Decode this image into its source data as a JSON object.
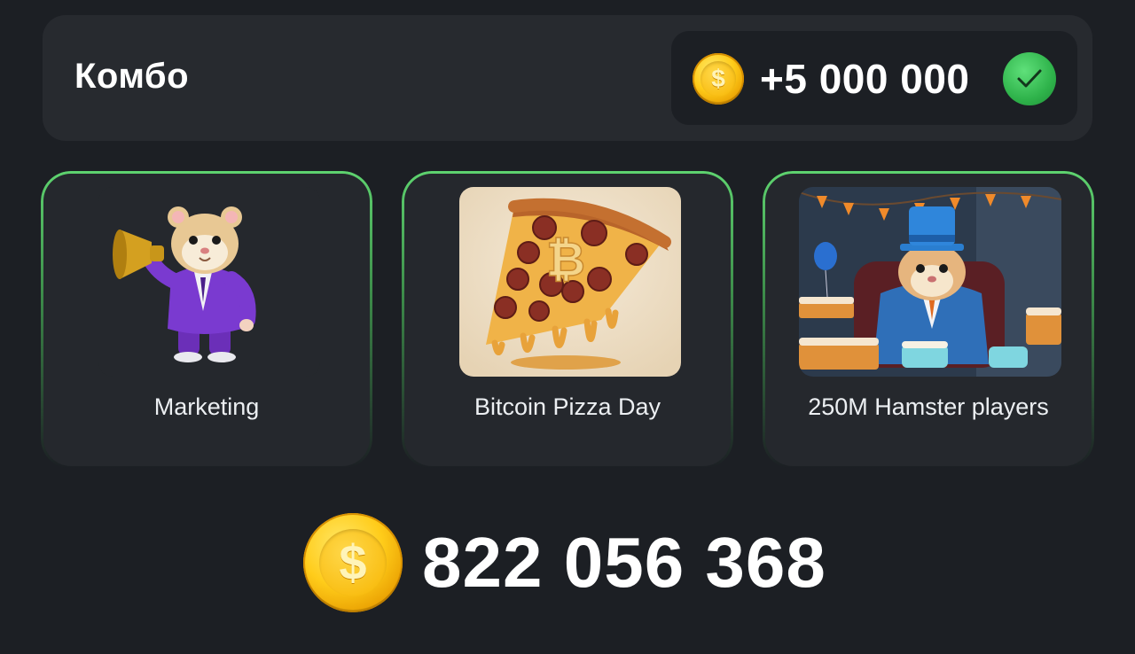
{
  "combo": {
    "title": "Комбо",
    "reward": "+5 000 000",
    "reward_icon": "coin-icon",
    "status_icon": "check-icon",
    "status_color": "#2fb34b"
  },
  "cards": [
    {
      "label": "Marketing",
      "image": "hamster-megaphone-image"
    },
    {
      "label": "Bitcoin Pizza Day",
      "image": "bitcoin-pizza-image"
    },
    {
      "label": "250M Hamster players",
      "image": "hamster-party-image"
    }
  ],
  "balance": {
    "value": "822 056 368",
    "icon": "coin-icon"
  },
  "colors": {
    "background": "#1c1f24",
    "panel": "#272a2f",
    "card_border": "#5ed36f",
    "coin": "#ffcc1a"
  }
}
